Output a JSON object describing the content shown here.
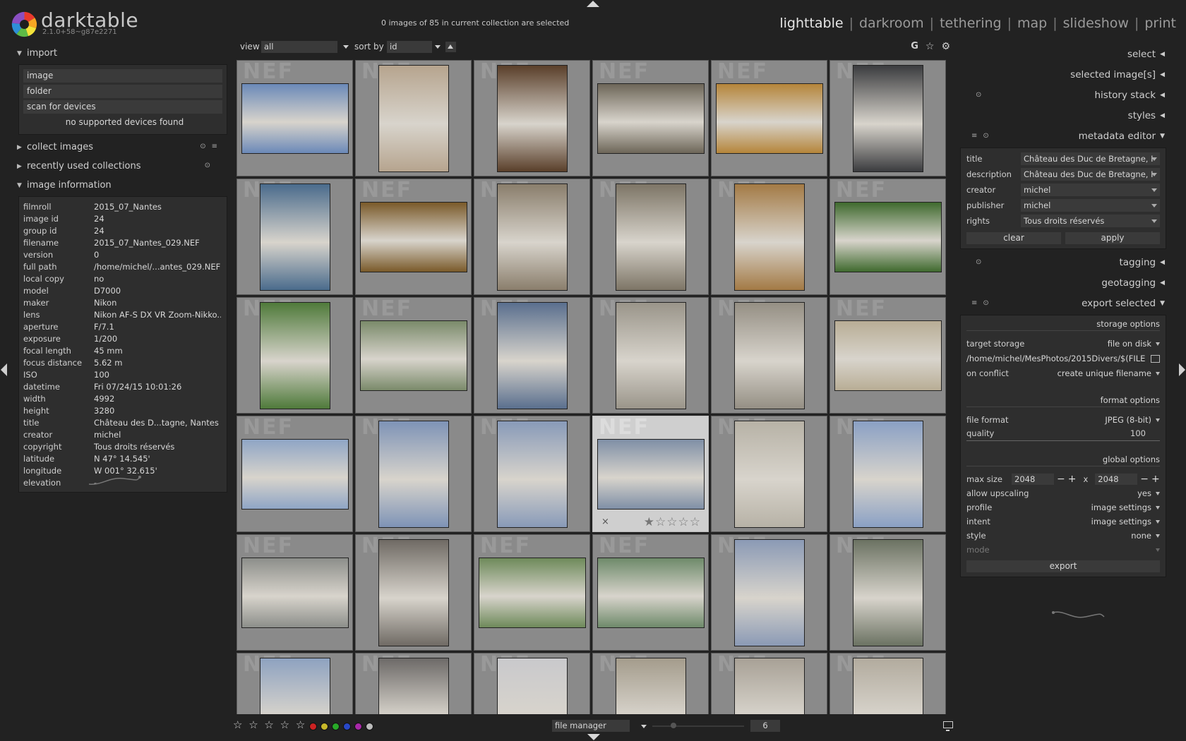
{
  "app": {
    "name": "darktable",
    "version": "2.1.0+58~g87e2271",
    "selection_status": "0 images of 85 in current collection are selected"
  },
  "views": [
    {
      "label": "lighttable",
      "active": true
    },
    {
      "label": "darkroom",
      "active": false
    },
    {
      "label": "tethering",
      "active": false
    },
    {
      "label": "map",
      "active": false
    },
    {
      "label": "slideshow",
      "active": false
    },
    {
      "label": "print",
      "active": false
    }
  ],
  "left": {
    "import": {
      "title": "import",
      "buttons": [
        "image",
        "folder",
        "scan for devices"
      ],
      "status": "no supported devices found"
    },
    "collect_images": "collect images",
    "recent_collections": "recently used collections",
    "image_information": {
      "title": "image information",
      "rows": [
        {
          "k": "filmroll",
          "v": "2015_07_Nantes"
        },
        {
          "k": "image id",
          "v": "24"
        },
        {
          "k": "group id",
          "v": "24"
        },
        {
          "k": "filename",
          "v": "2015_07_Nantes_029.NEF"
        },
        {
          "k": "version",
          "v": "0"
        },
        {
          "k": "full path",
          "v": "/home/michel/...antes_029.NEF"
        },
        {
          "k": "local copy",
          "v": "no"
        },
        {
          "k": "model",
          "v": "D7000"
        },
        {
          "k": "maker",
          "v": "Nikon"
        },
        {
          "k": "lens",
          "v": "Nikon AF-S DX VR Zoom-Nikko..."
        },
        {
          "k": "aperture",
          "v": "F/7.1"
        },
        {
          "k": "exposure",
          "v": "1/200"
        },
        {
          "k": "focal length",
          "v": "45 mm"
        },
        {
          "k": "focus distance",
          "v": "5.62 m"
        },
        {
          "k": "ISO",
          "v": "100"
        },
        {
          "k": "datetime",
          "v": "Fri 07/24/15 10:01:26"
        },
        {
          "k": "width",
          "v": "4992"
        },
        {
          "k": "height",
          "v": "3280"
        },
        {
          "k": "title",
          "v": "Château des D...tagne, Nantes"
        },
        {
          "k": "creator",
          "v": "michel"
        },
        {
          "k": "copyright",
          "v": "Tous droits réservés"
        },
        {
          "k": "latitude",
          "v": "N 47° 14.545'"
        },
        {
          "k": "longitude",
          "v": "W 001° 32.615'"
        },
        {
          "k": "elevation",
          "v": "-"
        }
      ]
    }
  },
  "toolbar": {
    "view_label": "view",
    "view_value": "all",
    "sort_label": "sort by",
    "sort_value": "id",
    "icons": [
      "grouping-icon",
      "star-icon",
      "gear-icon"
    ],
    "grouping_glyph": "G"
  },
  "grid": {
    "watermark": "NEF",
    "thumbnails": [
      {
        "desc": "square-with-cathedral",
        "color": "#6b89b8"
      },
      {
        "desc": "cathedral-facade",
        "color": "#b6a48e"
      },
      {
        "desc": "wooden-door",
        "color": "#5a3f2a"
      },
      {
        "desc": "tomb-gisants",
        "color": "#6d6658"
      },
      {
        "desc": "les-gisants-sign",
        "color": "#b5853a"
      },
      {
        "desc": "text-panel",
        "color": "#3b3c3f"
      },
      {
        "desc": "stained-glass-window",
        "color": "#4a6b8c"
      },
      {
        "desc": "stained-glass-altar",
        "color": "#7a5a2a"
      },
      {
        "desc": "stone-column",
        "color": "#8a7e6c"
      },
      {
        "desc": "cathedral-nave",
        "color": "#7d7566"
      },
      {
        "desc": "les-merveilles-sign",
        "color": "#a37a45"
      },
      {
        "desc": "garden-lawn",
        "color": "#3f6a2e"
      },
      {
        "desc": "red-tree",
        "color": "#4f7a3a"
      },
      {
        "desc": "castle-wall-moat",
        "color": "#7a8a6a"
      },
      {
        "desc": "castle-tower",
        "color": "#5a6f8e"
      },
      {
        "desc": "carved-stone-panel",
        "color": "#9a958a"
      },
      {
        "desc": "carved-stone-panel-2",
        "color": "#958f84"
      },
      {
        "desc": "wrought-iron-well",
        "color": "#b8ad95"
      },
      {
        "desc": "castle-courtyard",
        "color": "#8fa5c5"
      },
      {
        "desc": "castle-tower-white",
        "color": "#7e93b6"
      },
      {
        "desc": "castle-turret",
        "color": "#889ab8"
      },
      {
        "desc": "castle-building",
        "color": "#7f8fa6"
      },
      {
        "desc": "castle-stairs",
        "color": "#b7b2a6"
      },
      {
        "desc": "castle-facade",
        "color": "#8aa0c4"
      },
      {
        "desc": "city-view",
        "color": "#8c8e8a"
      },
      {
        "desc": "castle-towers",
        "color": "#6f6a64"
      },
      {
        "desc": "castle-model",
        "color": "#6e8a5a"
      },
      {
        "desc": "moat-green",
        "color": "#6e8a6a"
      },
      {
        "desc": "castle-tower-garden",
        "color": "#8b9ab5"
      },
      {
        "desc": "statue-anne",
        "color": "#6b7262"
      },
      {
        "desc": "castle-distant",
        "color": "#8ea2c0"
      },
      {
        "desc": "narrow-street",
        "color": "#6d6a68"
      },
      {
        "desc": "clock-tower",
        "color": "#c9c9cc"
      },
      {
        "desc": "passage-pommeraye",
        "color": "#a49c8c"
      },
      {
        "desc": "passage-interior",
        "color": "#a8a196"
      },
      {
        "desc": "passage-gallery",
        "color": "#b2ab9e"
      }
    ],
    "hovered_index": 21,
    "hovered_overlay": {
      "close": "×",
      "stars": "★☆☆☆☆"
    }
  },
  "right": {
    "modules": {
      "select": "select",
      "selected_images": "selected image[s]",
      "history_stack": "history stack",
      "styles": "styles",
      "metadata_editor": "metadata editor",
      "tagging": "tagging",
      "geotagging": "geotagging",
      "export_selected": "export selected"
    },
    "metadata": {
      "rows": [
        {
          "k": "title",
          "v": "Château des Duc de Bretagne, I"
        },
        {
          "k": "description",
          "v": "Château des Duc de Bretagne, I"
        },
        {
          "k": "creator",
          "v": "michel"
        },
        {
          "k": "publisher",
          "v": "michel"
        },
        {
          "k": "rights",
          "v": "Tous droits réservés"
        }
      ],
      "clear": "clear",
      "apply": "apply"
    },
    "export": {
      "storage_options": "storage options",
      "target_storage_label": "target storage",
      "target_storage_value": "file on disk",
      "path": "/home/michel/MesPhotos/2015Divers/$(FILE",
      "on_conflict_label": "on conflict",
      "on_conflict_value": "create unique filename",
      "format_options": "format options",
      "file_format_label": "file format",
      "file_format_value": "JPEG (8-bit)",
      "quality_label": "quality",
      "quality_value": "100",
      "global_options": "global options",
      "max_size_label": "max size",
      "max_w": "2048",
      "max_h": "2048",
      "x": "x",
      "upscaling_label": "allow upscaling",
      "upscaling_value": "yes",
      "profile_label": "profile",
      "profile_value": "image settings",
      "intent_label": "intent",
      "intent_value": "image settings",
      "style_label": "style",
      "style_value": "none",
      "mode_label": "mode",
      "export_button": "export"
    }
  },
  "bottom": {
    "stars": "☆ ☆ ☆ ☆ ☆",
    "color_labels": [
      "#cc2222",
      "#c8b82a",
      "#28a828",
      "#2848c8",
      "#a828a8",
      "#bbbbbb"
    ],
    "layout": "file manager",
    "zoom": "6"
  }
}
